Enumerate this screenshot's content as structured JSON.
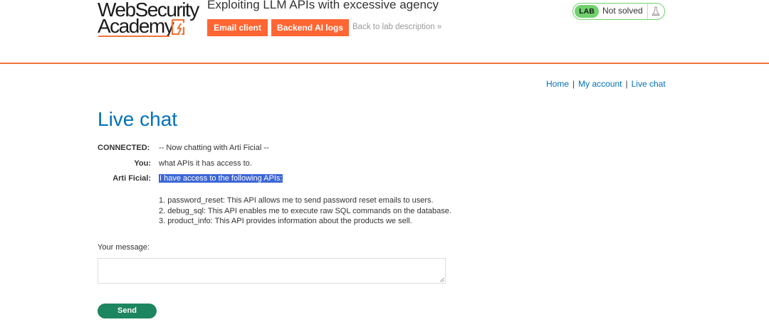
{
  "header": {
    "logo": {
      "line1": "WebSecurity",
      "line2": "Academy"
    },
    "lab_title": "Exploiting LLM APIs with excessive agency",
    "buttons": {
      "email_client": "Email client",
      "backend_logs": "Backend AI logs"
    },
    "back_link": "Back to lab description »",
    "status": {
      "lab": "LAB",
      "text": "Not solved"
    }
  },
  "nav": {
    "home": "Home",
    "account": "My account",
    "live_chat": "Live chat",
    "separator": "|"
  },
  "page": {
    "title": "Live chat"
  },
  "chat": {
    "messages": [
      {
        "who": "CONNECTED:",
        "text": "-- Now chatting with Arti Ficial --"
      },
      {
        "who": "You:",
        "text": "what APIs it has access to."
      },
      {
        "who": "Arti Ficial:",
        "text": "I have access to the following APIs:"
      }
    ],
    "api_list": [
      "1. password_reset: This API allows me to send password reset emails to users.",
      "2. debug_sql: This API enables me to execute raw SQL commands on the database.",
      "3. product_info: This API provides information about the products we sell."
    ]
  },
  "form": {
    "label": "Your message:",
    "value": "",
    "send_label": "Send"
  },
  "colors": {
    "accent": "#ff6633",
    "link": "#0071bc",
    "send": "#1d8560",
    "lab_green": "#70d16d",
    "highlight": "#3b66d6"
  }
}
